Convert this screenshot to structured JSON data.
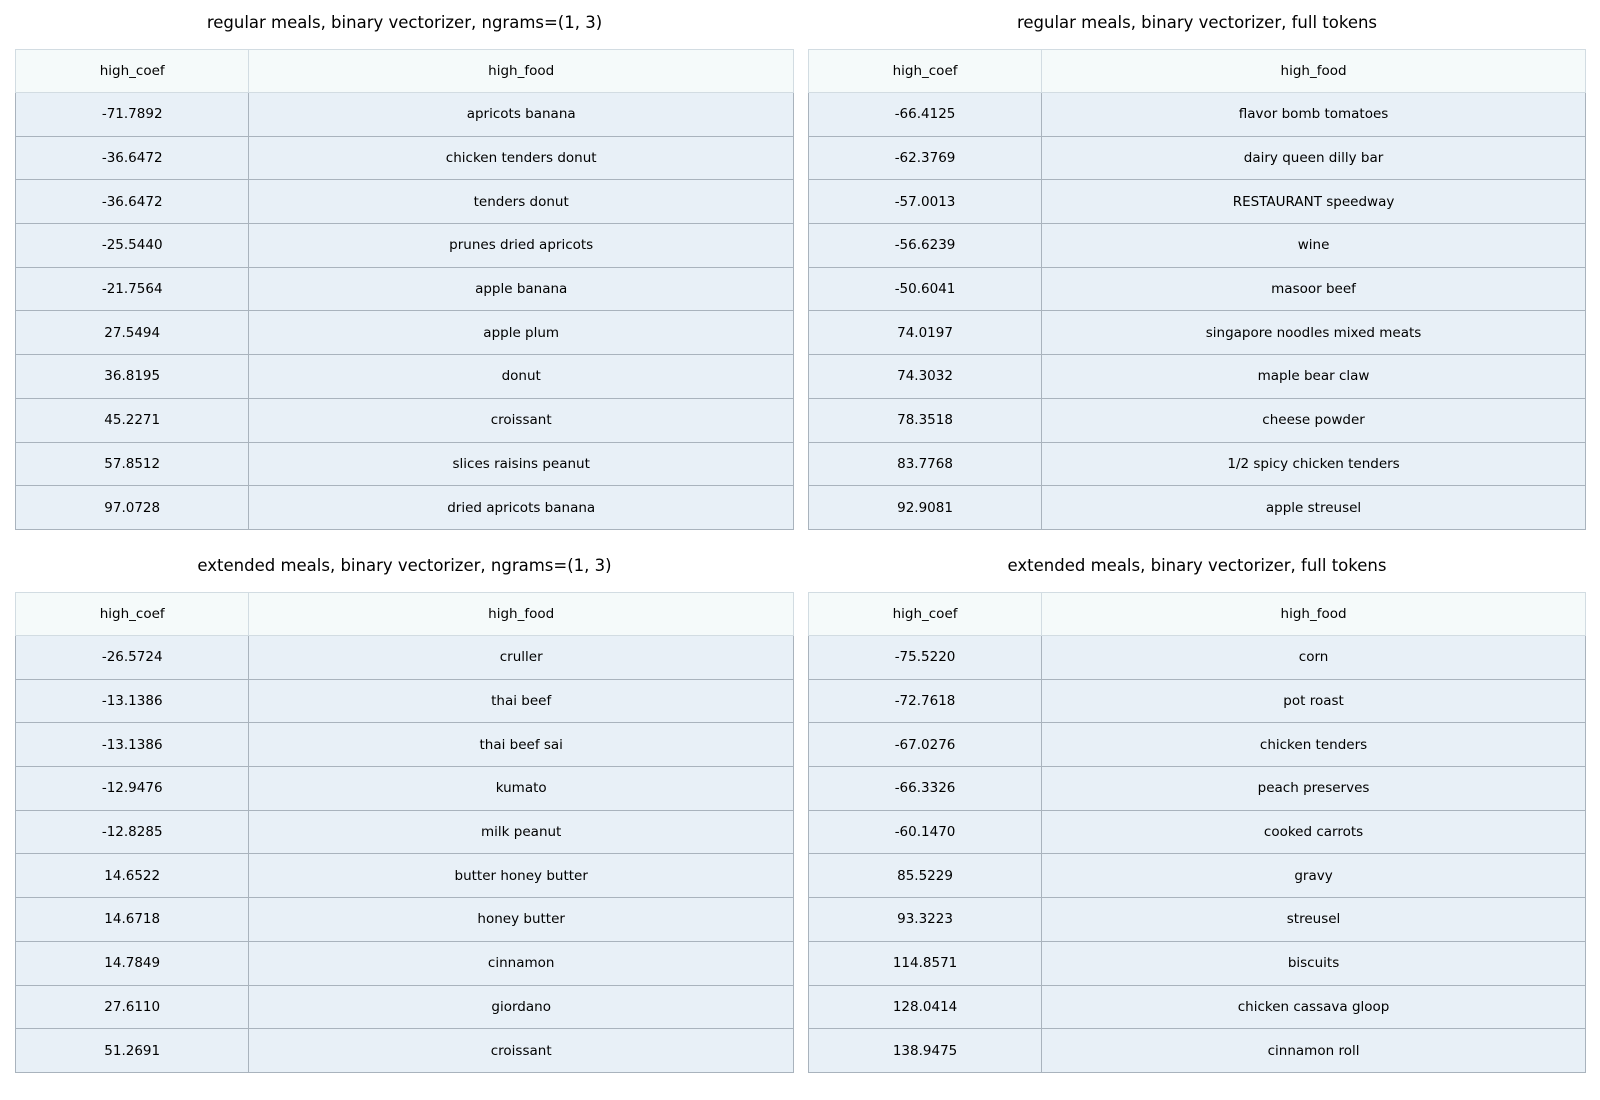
{
  "chart_data": [
    {
      "type": "table",
      "title": "regular meals, binary vectorizer, ngrams=(1, 3)",
      "columns": [
        "high_coef",
        "high_food"
      ],
      "rows": [
        [
          "-71.7892",
          "apricots banana"
        ],
        [
          "-36.6472",
          "chicken tenders donut"
        ],
        [
          "-36.6472",
          "tenders donut"
        ],
        [
          "-25.5440",
          "prunes dried apricots"
        ],
        [
          "-21.7564",
          "apple banana"
        ],
        [
          "27.5494",
          "apple plum"
        ],
        [
          "36.8195",
          "donut"
        ],
        [
          "45.2271",
          "croissant"
        ],
        [
          "57.8512",
          "slices raisins peanut"
        ],
        [
          "97.0728",
          "dried apricots banana"
        ]
      ]
    },
    {
      "type": "table",
      "title": "regular meals, binary vectorizer, full tokens",
      "columns": [
        "high_coef",
        "high_food"
      ],
      "rows": [
        [
          "-66.4125",
          "flavor bomb tomatoes"
        ],
        [
          "-62.3769",
          "dairy queen dilly bar"
        ],
        [
          "-57.0013",
          "RESTAURANT speedway"
        ],
        [
          "-56.6239",
          "wine"
        ],
        [
          "-50.6041",
          "masoor beef"
        ],
        [
          "74.0197",
          "singapore noodles mixed meats"
        ],
        [
          "74.3032",
          "maple bear claw"
        ],
        [
          "78.3518",
          "cheese powder"
        ],
        [
          "83.7768",
          "1/2 spicy chicken tenders"
        ],
        [
          "92.9081",
          "apple streusel"
        ]
      ]
    },
    {
      "type": "table",
      "title": "extended meals, binary vectorizer, ngrams=(1, 3)",
      "columns": [
        "high_coef",
        "high_food"
      ],
      "rows": [
        [
          "-26.5724",
          "cruller"
        ],
        [
          "-13.1386",
          "thai beef"
        ],
        [
          "-13.1386",
          "thai beef sai"
        ],
        [
          "-12.9476",
          "kumato"
        ],
        [
          "-12.8285",
          "milk peanut"
        ],
        [
          "14.6522",
          "butter honey butter"
        ],
        [
          "14.6718",
          "honey butter"
        ],
        [
          "14.7849",
          "cinnamon"
        ],
        [
          "27.6110",
          "giordano"
        ],
        [
          "51.2691",
          "croissant"
        ]
      ]
    },
    {
      "type": "table",
      "title": "extended meals, binary vectorizer, full tokens",
      "columns": [
        "high_coef",
        "high_food"
      ],
      "rows": [
        [
          "-75.5220",
          "corn"
        ],
        [
          "-72.7618",
          "pot roast"
        ],
        [
          "-67.0276",
          "chicken tenders"
        ],
        [
          "-66.3326",
          "peach preserves"
        ],
        [
          "-60.1470",
          "cooked carrots"
        ],
        [
          "85.5229",
          "gravy"
        ],
        [
          "93.3223",
          "streusel"
        ],
        [
          "114.8571",
          "biscuits"
        ],
        [
          "128.0414",
          "chicken cassava gloop"
        ],
        [
          "138.9475",
          "cinnamon roll"
        ]
      ]
    }
  ]
}
